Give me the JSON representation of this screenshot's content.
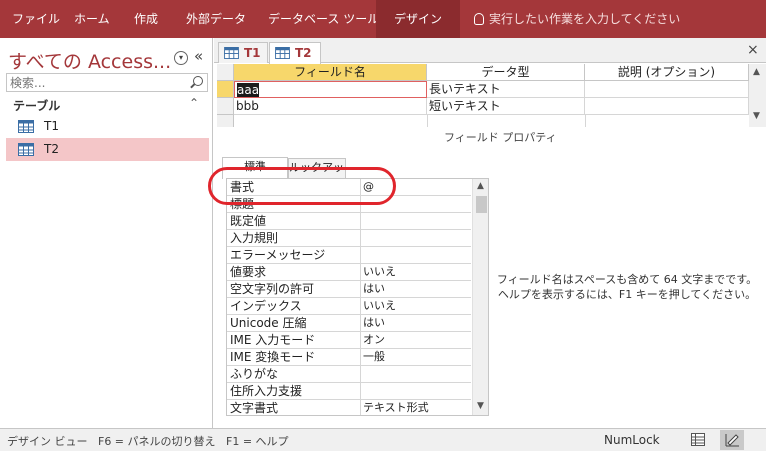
{
  "ribbon": {
    "tabs": [
      "ファイル",
      "ホーム",
      "作成",
      "外部データ",
      "データベース ツール",
      "デザイン"
    ],
    "active_tab": "デザイン",
    "tell_me": "実行したい作業を入力してください"
  },
  "nav": {
    "title": "すべての Access...",
    "search_placeholder": "検索...",
    "group_label": "テーブル",
    "items": [
      {
        "label": "T1",
        "selected": false
      },
      {
        "label": "T2",
        "selected": true
      }
    ]
  },
  "doc_tabs": [
    {
      "label": "T1",
      "active": false
    },
    {
      "label": "T2",
      "active": true
    }
  ],
  "field_grid": {
    "headers": [
      "フィールド名",
      "データ型",
      "説明 (オプション)"
    ],
    "rows": [
      {
        "name": "aaa",
        "type": "長いテキスト",
        "description": ""
      },
      {
        "name": "bbb",
        "type": "短いテキスト",
        "description": ""
      }
    ]
  },
  "properties": {
    "title": "フィールド プロパティ",
    "tabs": [
      "標準",
      "ルックアップ"
    ],
    "rows": [
      {
        "name": "書式",
        "value": "@"
      },
      {
        "name": "標題",
        "value": ""
      },
      {
        "name": "既定値",
        "value": ""
      },
      {
        "name": "入力規則",
        "value": ""
      },
      {
        "name": "エラーメッセージ",
        "value": ""
      },
      {
        "name": "値要求",
        "value": "いいえ"
      },
      {
        "name": "空文字列の許可",
        "value": "はい"
      },
      {
        "name": "インデックス",
        "value": "いいえ"
      },
      {
        "name": "Unicode 圧縮",
        "value": "はい"
      },
      {
        "name": "IME 入力モード",
        "value": "オン"
      },
      {
        "name": "IME 変換モード",
        "value": "一般"
      },
      {
        "name": "ふりがな",
        "value": ""
      },
      {
        "name": "住所入力支援",
        "value": ""
      },
      {
        "name": "文字書式",
        "value": "テキスト形式"
      }
    ],
    "help_line1": "フィールド名はスペースも含めて 64 文字までです。",
    "help_line2": "ヘルプを表示するには、F1 キーを押してください。"
  },
  "status_bar": {
    "text": "デザイン ビュー   F6 = パネルの切り替え   F1 = ヘルプ",
    "numlock": "NumLock"
  },
  "colors": {
    "accent": "#a4373a",
    "selected_item": "#f4c6c8",
    "header_highlight": "#f7d76b",
    "annotation": "#e0252c"
  }
}
